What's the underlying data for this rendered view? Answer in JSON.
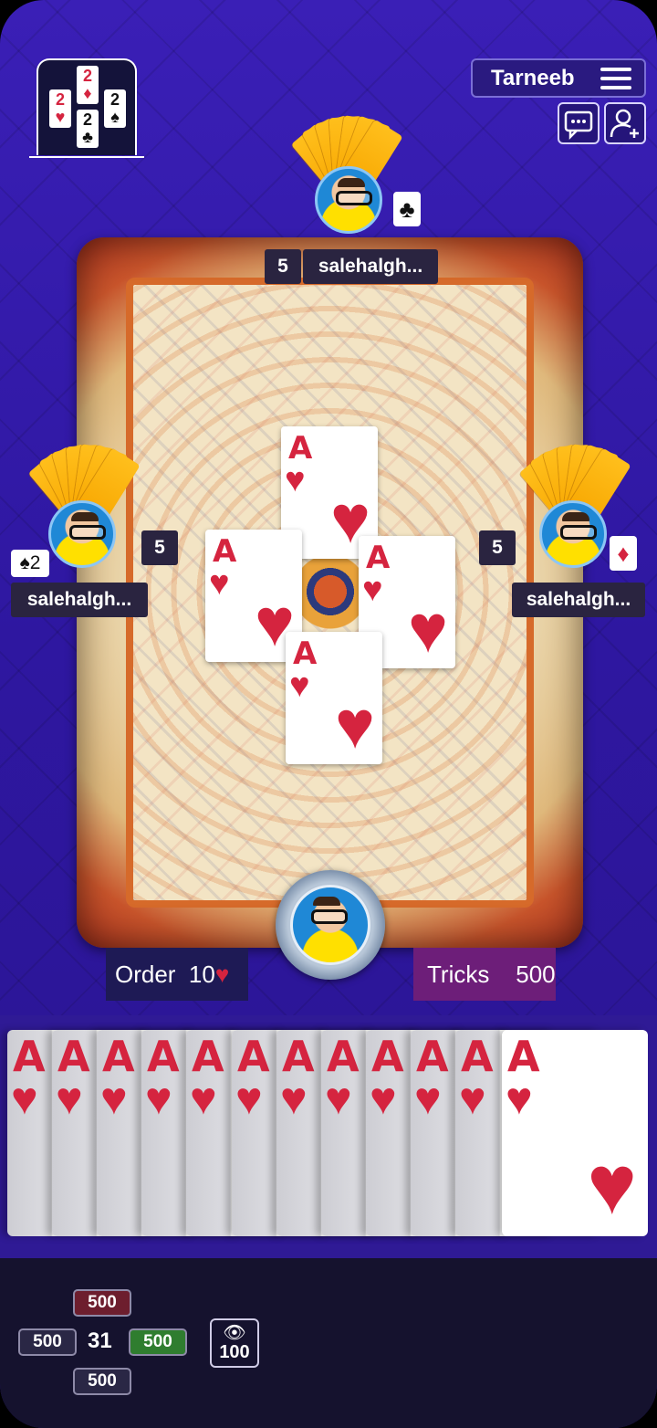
{
  "header": {
    "game_title": "Tarneeb",
    "logo_cards": [
      {
        "rank": "2",
        "suit": "♦",
        "color": "red"
      },
      {
        "rank": "2",
        "suit": "♥",
        "color": "red"
      },
      {
        "rank": "2",
        "suit": "♠",
        "color": "black"
      },
      {
        "rank": "2",
        "suit": "♣",
        "color": "black"
      }
    ]
  },
  "players": {
    "top": {
      "name": "salehalgh...",
      "count": "5",
      "suit": "♣"
    },
    "left": {
      "name": "salehalgh...",
      "count": "5",
      "suit": "♠",
      "suit_value": "2"
    },
    "right": {
      "name": "salehalgh...",
      "count": "5",
      "suit": "♦"
    }
  },
  "table_cards": [
    {
      "rank": "A",
      "suit": "♥"
    },
    {
      "rank": "A",
      "suit": "♥"
    },
    {
      "rank": "A",
      "suit": "♥"
    },
    {
      "rank": "A",
      "suit": "♥"
    }
  ],
  "status": {
    "order_label": "Order",
    "order_value": "10",
    "order_suit": "♥",
    "tricks_label": "Tricks",
    "tricks_value": "500"
  },
  "hand": [
    {
      "rank": "A",
      "suit": "♥"
    },
    {
      "rank": "A",
      "suit": "♥"
    },
    {
      "rank": "A",
      "suit": "♥"
    },
    {
      "rank": "A",
      "suit": "♥"
    },
    {
      "rank": "A",
      "suit": "♥"
    },
    {
      "rank": "A",
      "suit": "♥"
    },
    {
      "rank": "A",
      "suit": "♥"
    },
    {
      "rank": "A",
      "suit": "♥"
    },
    {
      "rank": "A",
      "suit": "♥"
    },
    {
      "rank": "A",
      "suit": "♥"
    },
    {
      "rank": "A",
      "suit": "♥"
    },
    {
      "rank": "A",
      "suit": "♥"
    }
  ],
  "scores": {
    "top": "500",
    "left": "500",
    "right": "500",
    "bottom": "500",
    "center": "31"
  },
  "spectators": {
    "icon": "eye-icon",
    "count": "100"
  },
  "colors": {
    "accent_red": "#d5243f",
    "card_back": "#f7a600",
    "background": "#2e17a0"
  }
}
